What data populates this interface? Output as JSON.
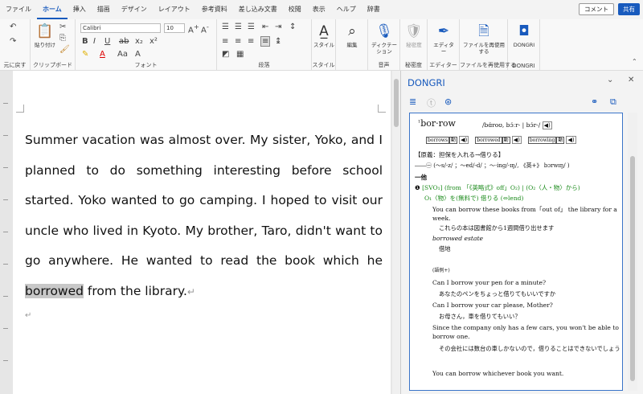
{
  "tabs": [
    "ファイル",
    "ホーム",
    "挿入",
    "描画",
    "デザイン",
    "レイアウト",
    "参考資料",
    "差し込み文書",
    "校閲",
    "表示",
    "ヘルプ",
    "辞書"
  ],
  "active_tab": "ホーム",
  "top_right": {
    "comment": "コメント",
    "share": "共有"
  },
  "ribbon": {
    "undo_label": "元に戻す",
    "clipboard_label": "クリップボード",
    "paste_label": "貼り付け",
    "font_label": "フォント",
    "font_name": "Calibri",
    "font_size": "10",
    "paragraph_label": "段落",
    "style_label": "スタイル",
    "styles_btn": "スタイル",
    "edit_btn": "編集",
    "voice_label": "音声",
    "dictation_btn": "ディクテーション",
    "sensitivity_label": "秘密度",
    "sensitivity_btn": "秘密度",
    "editor_label": "エディター",
    "editor_btn": "エディター",
    "reuse_label": "ファイルを再使用する",
    "reuse_btn": "ファイルを再使用する",
    "dongri_label": "DONGRI",
    "dongri_btn": "DONGRI"
  },
  "document": {
    "before": "Summer vacation was almost over. My sister, Yoko, and I planned to do something interesting before school started. Yoko wanted to go camping. I hoped to visit our uncle who lived in Kyoto.  My brother, Taro, didn't want to go anywhere.  He wanted to read the book which he ",
    "highlight": "borrowed",
    "after": " from the library.",
    "para_mark": "↵"
  },
  "panel": {
    "title": "DONGRI",
    "dict": {
      "headword": "bor·row",
      "headword_sup": "1",
      "pron": "/bɑ́roʊ, bɔ́ːr- | bɔ́r-/",
      "speaker": "◀)",
      "forms": [
        {
          "label": "borrows",
          "tag": "動"
        },
        {
          "label": "borrowed",
          "tag": "動"
        },
        {
          "label": "borrowing",
          "tag": "動"
        }
      ],
      "origin": "【原義：担保を入れる→借りる】",
      "inflection": "――㊀ (〜s/-z/ ；〜ed/-d/ ；〜·ing/-ɪŋ/, 《英+》 bɔrwɪŋ/ )",
      "section": "一他",
      "sense_num": "❶",
      "sense_pattern": "[SVO₁] (from 「《英略式》off」O₂) | (O₂〈人・物〉から)",
      "sense_def": "O₁〈物〉を(無料で) 借りる (⇔lend)",
      "examples": [
        {
          "en": "You can borrow these books from「out of」 the library for a week.",
          "jp": "これらの本は図書館から1週間借り出せます"
        },
        {
          "en": "borrowed estate",
          "jp": "借地"
        },
        {
          "en": "(語例+)",
          "jp": ""
        },
        {
          "en": "Can I borrow your pen for a minute?",
          "jp": "あなたのペンをちょっと借りてもいいですか"
        },
        {
          "en": "Can I borrow your car please, Mother?",
          "jp": "お母さん，車を借りてもいい？"
        },
        {
          "en": "Since the company only has a few cars, you won't be able to borrow one.",
          "jp": "その会社には数台の車しかないので，借りることはできないでしょう"
        },
        {
          "en": "You can borrow whichever book you want.",
          "jp": ""
        }
      ]
    }
  }
}
